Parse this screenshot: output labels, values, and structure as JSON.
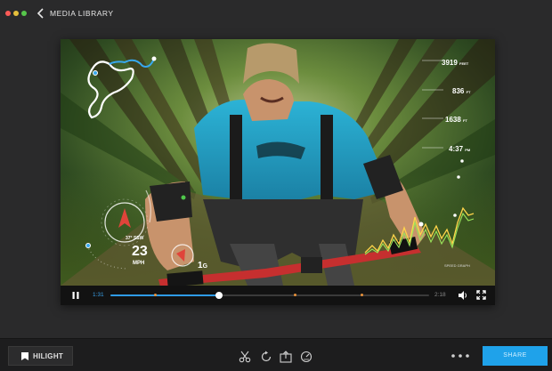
{
  "window": {
    "title": "MEDIA LIBRARY"
  },
  "video_overlay": {
    "stats": [
      {
        "value": "3919",
        "unit": "FEET"
      },
      {
        "value": "836",
        "unit": "FT"
      },
      {
        "value": "1638",
        "unit": "FT"
      },
      {
        "value": "4:37",
        "unit": "PM"
      }
    ],
    "heading": "37° SSW",
    "speed_value": "23",
    "speed_unit": "MPH",
    "gforce_value": "1",
    "gforce_unit": "G",
    "chart_label": "SPEED GRAPH"
  },
  "player": {
    "current_time": "1:31",
    "duration": "2:18",
    "progress": 0.34,
    "markers": [
      0.14,
      0.58,
      0.79
    ]
  },
  "bottom_bar": {
    "hilight_label": "HILIGHT",
    "share_label": "SHARE",
    "tools": [
      "scissors-icon",
      "rotate-icon",
      "export-frame-icon",
      "speed-icon"
    ]
  },
  "colors": {
    "accent": "#1fa2ea",
    "marker": "#e8913a",
    "background": "#2a2a2b"
  }
}
